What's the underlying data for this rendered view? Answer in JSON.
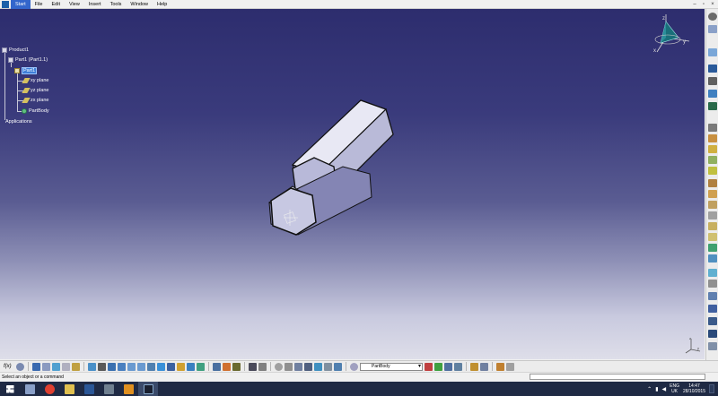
{
  "menubar": {
    "items": [
      "Start",
      "File",
      "Edit",
      "View",
      "Insert",
      "Tools",
      "Window",
      "Help"
    ],
    "active_index": 0
  },
  "tree": {
    "root": "Product1",
    "part_instance": "Part1 (Part1.1)",
    "part": "Part1",
    "planes": [
      "xy plane",
      "yz plane",
      "zx plane"
    ],
    "body": "PartBody",
    "applications": "Applications"
  },
  "toolbar": {
    "current_body": "PartBody",
    "fx_label": "f(x)"
  },
  "status": {
    "message": "Select an object or a command"
  },
  "taskbar": {
    "language_line1": "ENG",
    "language_line2": "UK",
    "time": "14:47",
    "date": "28/10/2015"
  },
  "compass": {
    "x_label": "x",
    "y_label": "y",
    "z_label": "z"
  },
  "colors": {
    "viewport_top": "#2d2d6e",
    "viewport_bottom": "#dedee9",
    "selection": "#3f7fd8",
    "compass": "#1a6f7a",
    "taskbar": "#1f2a44"
  }
}
